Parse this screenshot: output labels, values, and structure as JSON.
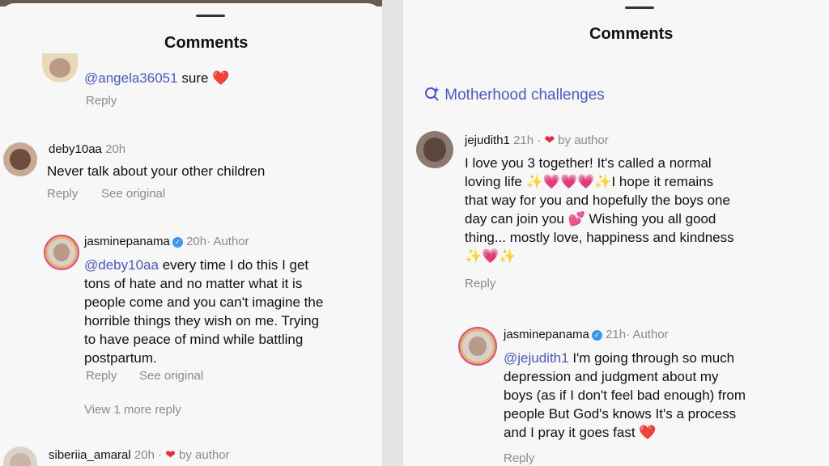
{
  "left": {
    "header": {
      "title": "Comments"
    },
    "comments": [
      {
        "mention": "@angela36051",
        "text": "sure",
        "actions": {
          "reply": "Reply"
        }
      },
      {
        "username": "deby10aa",
        "time": "20h",
        "text": "Never talk about your other children",
        "actions": {
          "reply": "Reply",
          "see_original": "See original"
        }
      },
      {
        "username": "jasminepanama",
        "time": "20h",
        "author_label": "· Author",
        "mention": "@deby10aa",
        "lines": [
          "every time I do this I get",
          "tons of hate and no matter what it is",
          "people come and you can't imagine the",
          "horrible things they wish on me. Trying",
          "to have peace of mind while battling",
          "postpartum."
        ],
        "actions": {
          "reply": "Reply",
          "see_original": "See original"
        }
      },
      {
        "view_more": "View 1 more reply"
      },
      {
        "username": "siberiia_amaral",
        "time": "20h ·",
        "liked_by": "by author"
      }
    ]
  },
  "right": {
    "header": {
      "title": "Comments"
    },
    "topic": {
      "icon": "search-sparkle-icon",
      "label": "Motherhood challenges"
    },
    "comments": [
      {
        "username": "jejudith1",
        "time": "21h ·",
        "liked_by": "by author",
        "lines": [
          "I love you 3 together! It's called a normal",
          "loving life",
          "I hope it remains",
          "that way for you and hopefully the boys one",
          "day can join you",
          "Wishing you all good",
          "thing... mostly love, happiness and kindness"
        ],
        "actions": {
          "reply": "Reply"
        }
      },
      {
        "username": "jasminepanama",
        "time": "21h",
        "author_label": "· Author",
        "mention": "@jejudith1",
        "lines": [
          "I'm going through so much",
          "depression and judgment about my",
          "boys (as if I don't feel bad enough) from",
          "people But God's knows It's a process",
          "and I pray it goes fast"
        ],
        "actions": {
          "reply": "Reply"
        }
      }
    ]
  },
  "colors": {
    "mention": "#4a58c9",
    "meta": "#8a8a8a",
    "heart": "#e22d3c",
    "verified": "#3897f0"
  }
}
